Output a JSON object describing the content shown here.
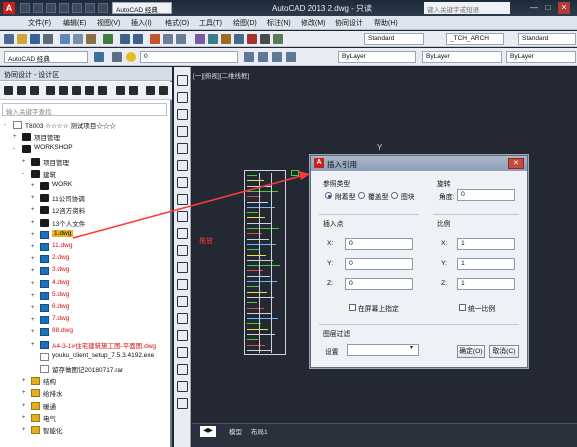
{
  "window": {
    "logo": "A",
    "title": "AutoCAD 2013    2.dwg - 只读",
    "workspace": "AutoCAD 经典",
    "search_placeholder": "键入关键字或短语",
    "min": "—",
    "max": "□",
    "close": "✕"
  },
  "menubar": [
    "文件(F)",
    "编辑(E)",
    "视图(V)",
    "插入(I)",
    "格式(O)",
    "工具(T)",
    "绘图(D)",
    "标注(N)",
    "修改(M)",
    "协同设计",
    "帮助(H)"
  ],
  "toolbar1": {
    "style1": "Standard",
    "style2": "_TCH_ARCH",
    "style3": "Standard"
  },
  "toolbar2": {
    "workspace": "AutoCAD 经典",
    "layer": "0",
    "color": "ByLayer",
    "linetype": "ByLayer",
    "lineweight": "ByLayer"
  },
  "left_panel": {
    "title": "协同设计 - 设计区",
    "search_placeholder": "输入关键字查找",
    "tree": [
      {
        "label": "T8003 ☆☆☆☆ 测试项目☆☆☆",
        "depth": 0,
        "icon": "file",
        "exp": "-"
      },
      {
        "label": "项目管理",
        "depth": 1,
        "icon": "folder",
        "exp": "+"
      },
      {
        "label": "WORKSHOP",
        "depth": 1,
        "icon": "folder",
        "exp": "-"
      },
      {
        "label": "项目管理",
        "depth": 2,
        "icon": "folder",
        "exp": "+"
      },
      {
        "label": "建筑",
        "depth": 2,
        "icon": "folder",
        "exp": "-"
      },
      {
        "label": "WORK",
        "depth": 3,
        "icon": "folder",
        "exp": "+"
      },
      {
        "label": "11公司协调",
        "depth": 3,
        "icon": "folder",
        "exp": "+"
      },
      {
        "label": "12咨方资料",
        "depth": 3,
        "icon": "folder",
        "exp": "+"
      },
      {
        "label": "13个人文件",
        "depth": 3,
        "icon": "folder",
        "exp": "+"
      },
      {
        "label": "1.dwg",
        "depth": 3,
        "icon": "dwg",
        "exp": "+",
        "style": "sel"
      },
      {
        "label": "11.dwg",
        "depth": 3,
        "icon": "dwg",
        "exp": "+",
        "style": "red"
      },
      {
        "label": "2.dwg",
        "depth": 3,
        "icon": "dwg",
        "exp": "+",
        "style": "red"
      },
      {
        "label": "3.dwg",
        "depth": 3,
        "icon": "dwg",
        "exp": "+",
        "style": "red"
      },
      {
        "label": "4.dwg",
        "depth": 3,
        "icon": "dwg",
        "exp": "+",
        "style": "red"
      },
      {
        "label": "5.dwg",
        "depth": 3,
        "icon": "dwg",
        "exp": "+",
        "style": "red"
      },
      {
        "label": "6.dwg",
        "depth": 3,
        "icon": "dwg",
        "exp": "+",
        "style": "red"
      },
      {
        "label": "7.dwg",
        "depth": 3,
        "icon": "dwg",
        "exp": "+",
        "style": "red"
      },
      {
        "label": "88.dwg",
        "depth": 3,
        "icon": "dwg",
        "exp": "+",
        "style": "red"
      },
      {
        "label": "A4-3-1#住宅建筑施工图-平面图.dwg",
        "depth": 3,
        "icon": "dwg",
        "exp": "+",
        "style": "red"
      },
      {
        "label": "youku_client_setup_7.5.3.4192.exe",
        "depth": 3,
        "icon": "file",
        "exp": ""
      },
      {
        "label": "留存做图记20180717.rar",
        "depth": 3,
        "icon": "file",
        "exp": ""
      },
      {
        "label": "结构",
        "depth": 2,
        "icon": "folder-y",
        "exp": "+"
      },
      {
        "label": "给排水",
        "depth": 2,
        "icon": "folder-y",
        "exp": "+"
      },
      {
        "label": "暖通",
        "depth": 2,
        "icon": "folder-y",
        "exp": "+"
      },
      {
        "label": "电气",
        "depth": 2,
        "icon": "folder-y",
        "exp": "+"
      },
      {
        "label": "智能化",
        "depth": 2,
        "icon": "folder-y",
        "exp": "+"
      }
    ]
  },
  "canvas": {
    "view_label": "[一][俯视][二维线框]",
    "ucs_label": "Y",
    "drag_label": "拖放"
  },
  "dialog": {
    "title": "插入引用",
    "close": "✕",
    "ref_type_label": "参照类型",
    "ref_types": [
      "附着型",
      "覆盖型",
      "图块"
    ],
    "rotation_label": "旋转",
    "angle_label": "角度:",
    "angle_value": "0",
    "insert_point_label": "插入点",
    "x_label": "X:",
    "x_value": "0",
    "y_label": "Y:",
    "y_value": "0",
    "z_label": "Z:",
    "z_value": "0",
    "on_screen_label": "在屏幕上指定",
    "scale_label": "比例",
    "sx_label": "X:",
    "sx_value": "1",
    "sy_label": "Y:",
    "sy_value": "1",
    "sz_label": "Z:",
    "sz_value": "1",
    "uniform_label": "统一比例",
    "filter_label": "图层过滤",
    "setting_label": "设置",
    "ok": "确定(O)",
    "cancel": "取消(C)"
  },
  "tabs": [
    "模型",
    "布局1"
  ]
}
